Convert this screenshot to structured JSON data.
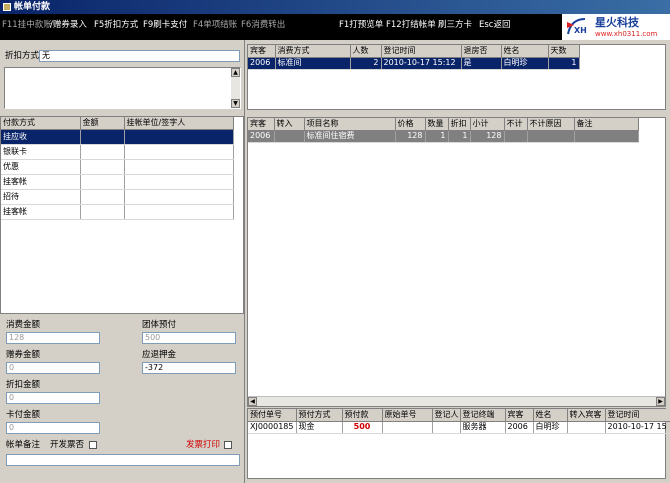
{
  "window": {
    "title": "帐单付款"
  },
  "hotkeys": [
    {
      "label": "F11挂中款账",
      "enabled": false
    },
    {
      "label": "/赠券录入",
      "enabled": true
    },
    {
      "label": "F5折扣方式",
      "enabled": true
    },
    {
      "label": "F9刷卡支付",
      "enabled": true
    },
    {
      "label": "F4单项结账",
      "enabled": false
    },
    {
      "label": "F6消费转出",
      "enabled": false
    },
    {
      "label": "F1打预览单",
      "enabled": true
    },
    {
      "label": "F12打结帐单",
      "enabled": true
    },
    {
      "label": "刷三方卡",
      "enabled": true
    },
    {
      "label": "Esc返回",
      "enabled": true
    }
  ],
  "logo": {
    "brand": "星火科技",
    "url": "www.xh0311.com"
  },
  "discount": {
    "label": "折扣方式",
    "value": "无"
  },
  "payment_table": {
    "headers": [
      "付款方式",
      "金额",
      "挂帐单位/签字人"
    ],
    "rows": [
      {
        "method": "挂应收",
        "amount": "",
        "unit": ""
      },
      {
        "method": "银联卡",
        "amount": "",
        "unit": ""
      },
      {
        "method": "优惠",
        "amount": "",
        "unit": ""
      },
      {
        "method": "挂客帐",
        "amount": "",
        "unit": ""
      },
      {
        "method": "招待",
        "amount": "",
        "unit": ""
      },
      {
        "method": "挂客帐",
        "amount": "",
        "unit": ""
      }
    ]
  },
  "summary": {
    "consume_label": "消费金额",
    "consume_value": "128",
    "group_label": "团体预付",
    "group_value": "500",
    "voucher_label": "赠券金额",
    "voucher_value": "0",
    "refund_label": "应退押金",
    "refund_value": "-372",
    "discount_label": "折扣金额",
    "discount_value": "0",
    "card_label": "卡付金额",
    "card_value": "0",
    "remark_label": "帐单备注",
    "invoice_no_label": "开发票否",
    "invoice_print_label": "发票打印"
  },
  "guest_table": {
    "headers": [
      "宾客",
      "消费方式",
      "人数",
      "登记时间",
      "退房否",
      "姓名",
      "天数"
    ],
    "rows": [
      {
        "guest": "2006",
        "type": "标准间",
        "people": "2",
        "time": "2010-10-17 15:12",
        "checkout": "是",
        "name": "白明珍",
        "days": "1"
      }
    ]
  },
  "items_table": {
    "headers": [
      "宾客",
      "转入",
      "项目名称",
      "价格",
      "数量",
      "折扣",
      "小计",
      "不计",
      "不计原因",
      "备注"
    ],
    "rows": [
      {
        "guest": "2006",
        "transfer": "",
        "item": "标准间住宿费",
        "price": "128",
        "qty": "1",
        "discount": "1",
        "subtotal": "128",
        "excl": "",
        "reason": "",
        "remark": ""
      }
    ]
  },
  "prepay_table": {
    "headers": [
      "预付单号",
      "预付方式",
      "预付款",
      "原始单号",
      "登记人",
      "登记终端",
      "宾客",
      "姓名",
      "转入宾客",
      "登记时间"
    ],
    "rows": [
      {
        "no": "XJ0000185",
        "method": "现金",
        "amount": "500",
        "orig": "",
        "registrar": "",
        "terminal": "服务器",
        "guest": "2006",
        "name": "白明珍",
        "transfer": "",
        "time": "2010-10-17 15"
      }
    ]
  },
  "colors": {
    "selection": "#0a246a",
    "prepay_amount": "#d00000",
    "invoice_print_label": "#d00000"
  }
}
